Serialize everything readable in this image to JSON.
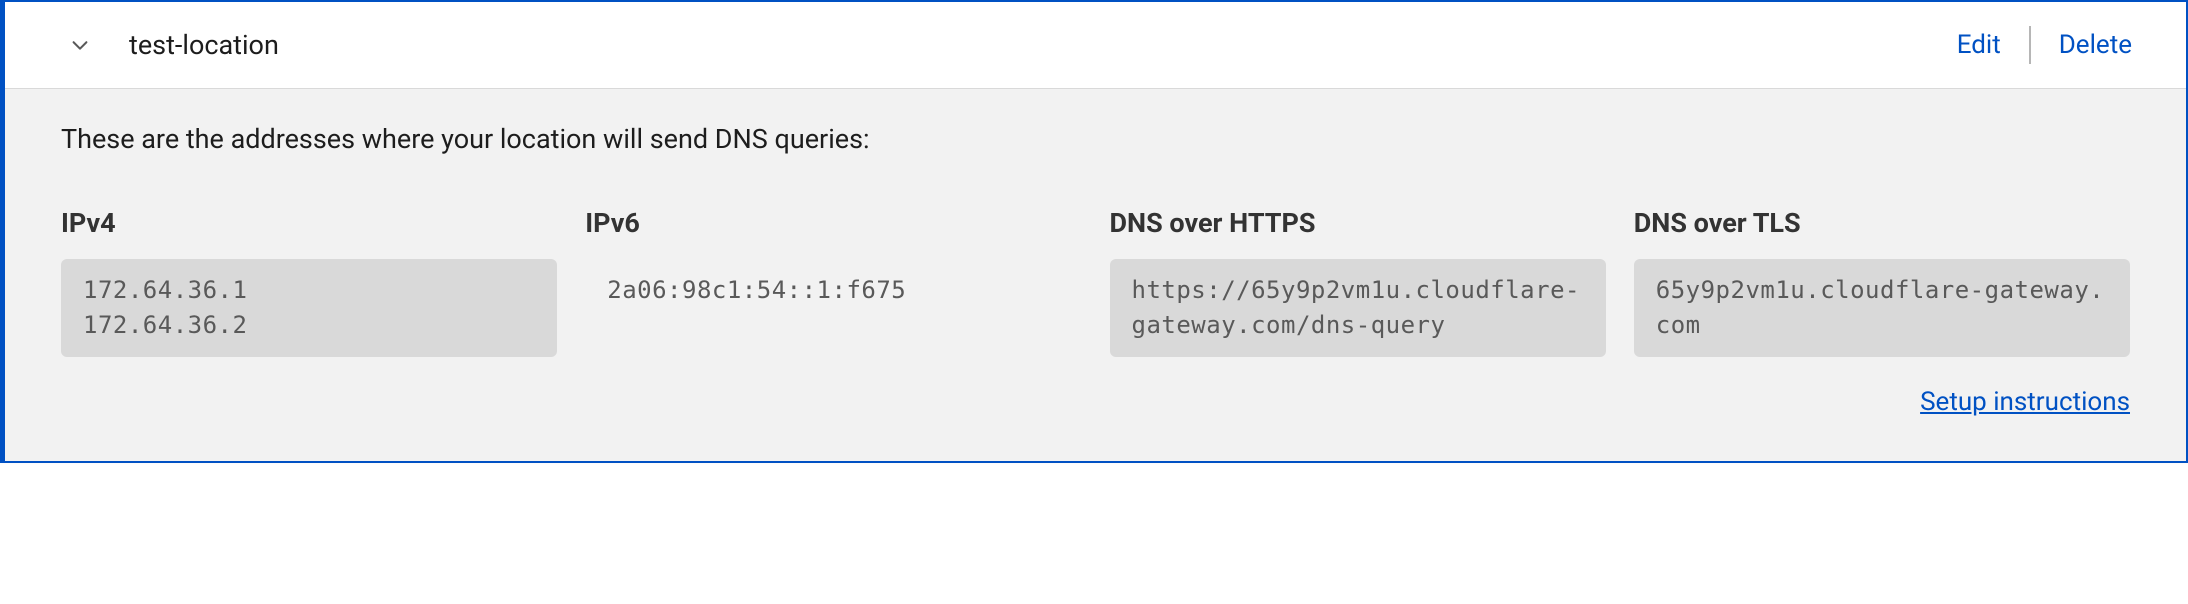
{
  "header": {
    "location_name": "test-location",
    "edit_label": "Edit",
    "delete_label": "Delete"
  },
  "body": {
    "description": "These are the addresses where your location will send DNS queries:",
    "columns": {
      "ipv4": {
        "heading": "IPv4",
        "value_line1": "172.64.36.1",
        "value_line2": "172.64.36.2"
      },
      "ipv6": {
        "heading": "IPv6",
        "value": "2a06:98c1:54::1:f675"
      },
      "doh": {
        "heading": "DNS over HTTPS",
        "value": "https://65y9p2vm1u.cloudflare-gateway.com/dns-query"
      },
      "dot": {
        "heading": "DNS over TLS",
        "value": "65y9p2vm1u.cloudflare-gateway.com"
      }
    },
    "setup_link": "Setup instructions"
  }
}
